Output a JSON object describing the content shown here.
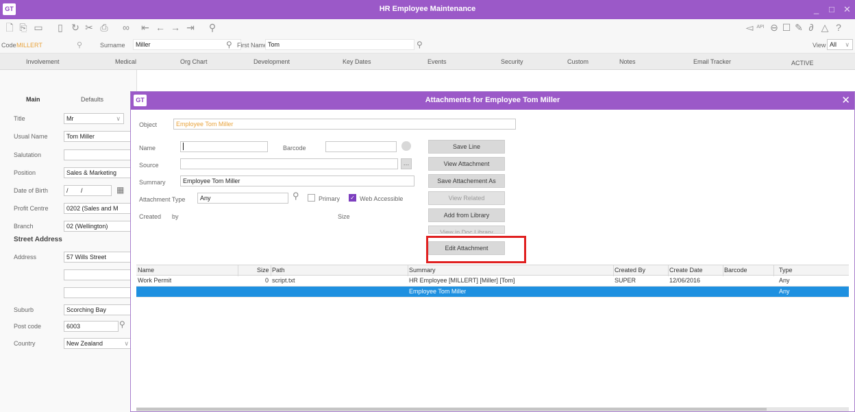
{
  "window": {
    "title": "HR Employee Maintenance",
    "logo": "GT",
    "controls": [
      "_",
      "□",
      "✕"
    ]
  },
  "toolbar": {
    "left_icons": [
      "new-icon",
      "copy-icon",
      "save-icon",
      "delete-icon",
      "refresh-icon",
      "tools-icon",
      "print-icon",
      "binoculars-icon",
      "first-icon",
      "prev-icon",
      "next-icon",
      "last-icon",
      "pin-icon"
    ],
    "right_icons": [
      "send-icon",
      "api-icon",
      "back-icon",
      "note-icon",
      "edit-icon",
      "attach-icon",
      "alert-icon",
      "help-icon"
    ],
    "api_label": "API"
  },
  "search": {
    "code_label": "Code",
    "code_value": "MILLERT",
    "surname_label": "Surname",
    "surname_value": "Miller",
    "firstname_label": "First Name",
    "firstname_value": "Tom",
    "view_label": "View",
    "view_value": "All"
  },
  "tabs": [
    "Involvement",
    "Medical",
    "Org Chart",
    "Development",
    "Key Dates",
    "Events",
    "Security",
    "Custom",
    "Notes",
    "Email Tracker"
  ],
  "status": "ACTIVE",
  "left": {
    "subtabs": [
      "Main",
      "Defaults"
    ],
    "fields": [
      {
        "label": "Title",
        "value": "Mr"
      },
      {
        "label": "Usual Name",
        "value": "Tom Miller"
      },
      {
        "label": "Salutation",
        "value": ""
      },
      {
        "label": "Position",
        "value": "Sales & Marketing"
      },
      {
        "label": "Date of Birth",
        "value": "/ /"
      },
      {
        "label": "Profit Centre",
        "value": "0202 (Sales and M"
      },
      {
        "label": "Branch",
        "value": "02 (Wellington)"
      }
    ],
    "street_address_heading": "Street Address",
    "address_label": "Address",
    "address_line1": "57 Wills Street",
    "suburb_label": "Suburb",
    "suburb_value": "Scorching Bay",
    "postcode_label": "Post code",
    "postcode_value": "6003",
    "country_label": "Country",
    "country_value": "New Zealand"
  },
  "dialog": {
    "logo": "GT",
    "title": "Attachments for Employee Tom Miller",
    "object_label": "Object",
    "object_value": "Employee Tom Miller",
    "name_label": "Name",
    "barcode_label": "Barcode",
    "source_label": "Source",
    "summary_label": "Summary",
    "summary_value": "Employee Tom Miller",
    "attachment_type_label": "Attachment Type",
    "attachment_type_value": "Any",
    "primary_label": "Primary",
    "web_accessible_label": "Web Accessible",
    "created_label": "Created",
    "by_label": "by",
    "size_label": "Size",
    "buttons": [
      "Save Line",
      "View Attachment",
      "Save Attachement As",
      "View Related",
      "Add from Library",
      "View in Doc Library",
      "Edit Attachment"
    ],
    "columns": [
      "Name",
      "Size",
      "Path",
      "Summary",
      "Created By",
      "Create Date",
      "Barcode",
      "Type"
    ],
    "rows": [
      {
        "name": "Work Permit",
        "size": "0",
        "path": "script.txt",
        "summary": "HR Employee [MILLERT] [Miller] [Tom]",
        "created_by": "SUPER",
        "create_date": "12/06/2016",
        "barcode": "",
        "type": "Any"
      },
      {
        "name": "",
        "size": "",
        "path": "",
        "summary": "Employee Tom Miller",
        "created_by": "",
        "create_date": "",
        "barcode": "",
        "type": "Any"
      }
    ]
  },
  "colors": {
    "accent": "#9b59c8",
    "highlight": "#e02020",
    "selection": "#1e90e0"
  }
}
